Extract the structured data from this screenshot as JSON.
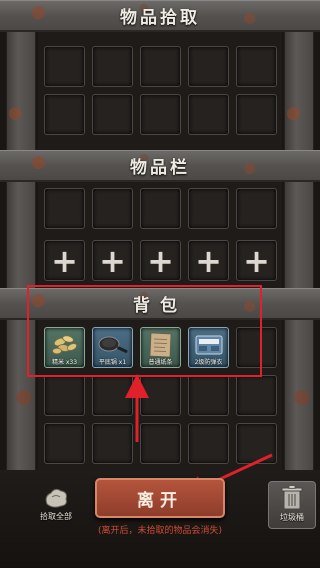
{
  "sections": {
    "pickup_title": "物品拾取",
    "inventory_title": "物品栏",
    "backpack_title": "背包"
  },
  "backpack_items": [
    {
      "name": "精米 x33"
    },
    {
      "name": "平底锅 x1"
    },
    {
      "name": "普通纸条"
    },
    {
      "name": "2级防弹衣"
    }
  ],
  "buttons": {
    "leave": "离开",
    "pickup_all": "拾取全部",
    "trash": "垃圾桶"
  },
  "note": "(离开后，未拾取的物品会消失)",
  "colors": {
    "highlight": "#e0202a",
    "leave_button": "#a24a35",
    "note_text": "#d34b35"
  }
}
